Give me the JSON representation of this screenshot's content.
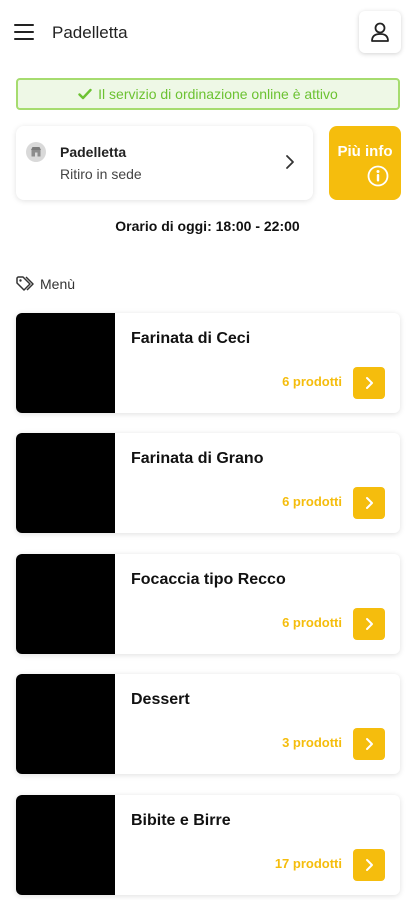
{
  "header": {
    "title": "Padelletta",
    "menu_icon": "hamburger-icon",
    "user_icon": "user-icon"
  },
  "status": {
    "text": "Il servizio di ordinazione online è attivo",
    "icon": "check-icon"
  },
  "location": {
    "name": "Padelletta",
    "mode": "Ritiro in sede",
    "icon": "store-icon"
  },
  "info_button": {
    "label": "Più info",
    "icon": "info-icon"
  },
  "hours": {
    "text": "Orario di oggi: 18:00 - 22:00"
  },
  "menu": {
    "heading": "Menù",
    "icon": "tag-icon",
    "categories": [
      {
        "name": "Farinata di Ceci",
        "count": "6 prodotti"
      },
      {
        "name": "Farinata di Grano",
        "count": "6 prodotti"
      },
      {
        "name": "Focaccia tipo Recco",
        "count": "6 prodotti"
      },
      {
        "name": "Dessert",
        "count": "3 prodotti"
      },
      {
        "name": "Bibite e Birre",
        "count": "17 prodotti"
      }
    ]
  },
  "colors": {
    "accent": "#f5bd0d",
    "status_green": "#6cc232",
    "status_bg": "#eef8e6",
    "status_border": "#a6dc6f"
  }
}
